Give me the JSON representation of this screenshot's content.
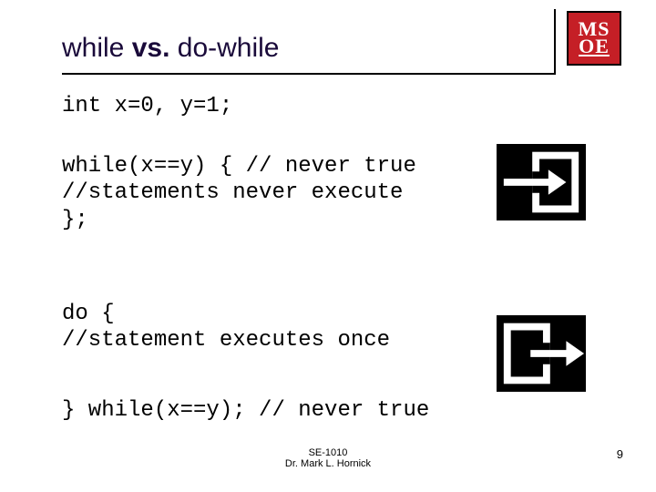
{
  "title": {
    "a": "while ",
    "vs": "vs.",
    "b": " do-while"
  },
  "logo": {
    "line1": "MS",
    "line2": "OE"
  },
  "code": {
    "decl": "int x=0, y=1;",
    "while_block": "while(x==y) { // never true\n//statements never execute\n};",
    "do_block1": "do {\n//statement executes once",
    "do_block2": "} while(x==y); // never true"
  },
  "footer": {
    "course": "SE-1010",
    "author": "Dr. Mark L. Hornick"
  },
  "page": "9"
}
